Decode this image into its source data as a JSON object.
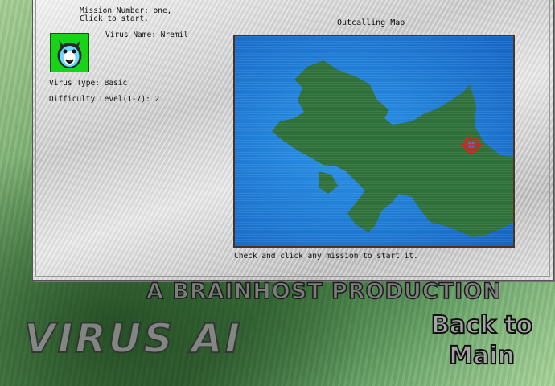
{
  "mission": {
    "number_text": "Mission Number: one,\nClick to start."
  },
  "virus": {
    "name_text": "Virus Name: Nremil",
    "type_text": "Virus Type: Basic",
    "difficulty_text": "Difficulty Level(1-7): 2"
  },
  "map": {
    "title": "Outcalling Map",
    "hint": "Check and click any mission to start it.",
    "water_color": "#1b6fc9",
    "land_color": "#2f6f3a",
    "marker_color": "#e0201a"
  },
  "footer": {
    "credit": "A BRAINHOST PRODUCTION",
    "logo": "VIRUS AI",
    "back_line1": "Back to",
    "back_line2": "Main"
  },
  "icons": {
    "avatar": "virus-creature-icon",
    "marker": "mission-target-icon"
  }
}
